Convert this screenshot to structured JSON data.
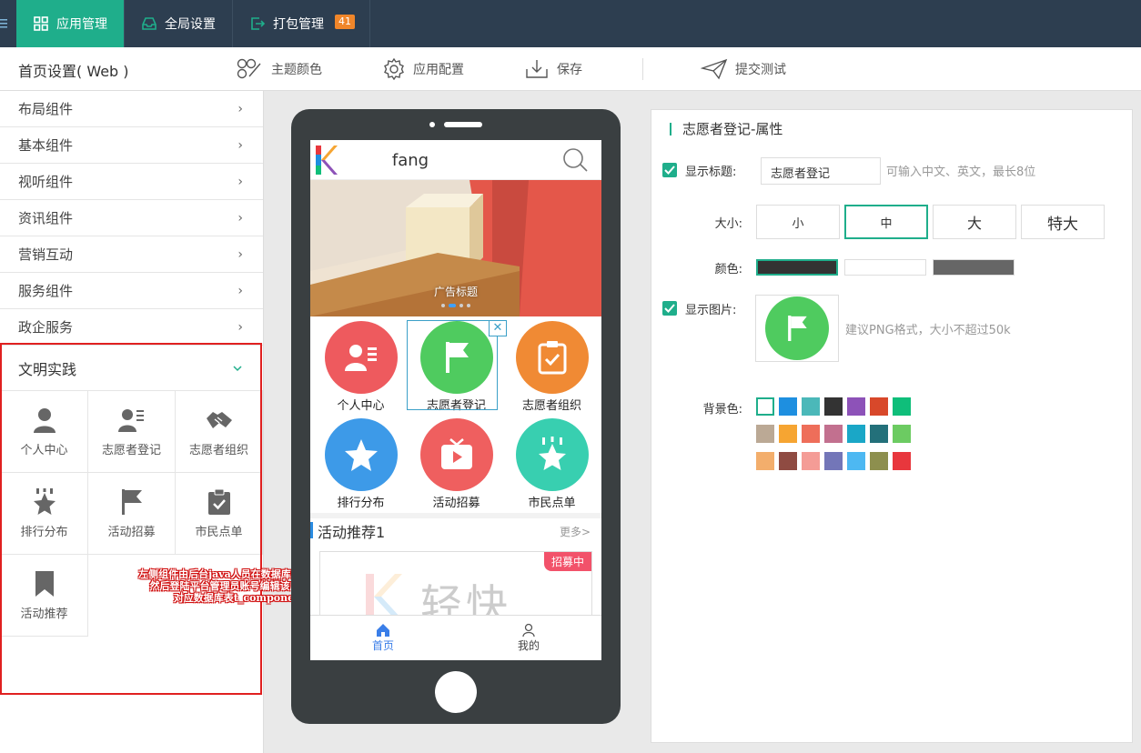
{
  "topbar": {
    "tabs": [
      {
        "label": "应用管理",
        "icon": "grid-icon",
        "active": true
      },
      {
        "label": "全局设置",
        "icon": "inbox-icon",
        "active": false
      },
      {
        "label": "打包管理",
        "icon": "export-icon",
        "active": false,
        "badge": "41"
      }
    ]
  },
  "subbar": {
    "page_title": "首页设置( Web )",
    "theme_color": "主题颜色",
    "app_config": "应用配置",
    "save": "保存",
    "submit_test": "提交测试"
  },
  "sidebar": {
    "categories": [
      "布局组件",
      "基本组件",
      "视听组件",
      "资讯组件",
      "营销互动",
      "服务组件",
      "政企服务"
    ],
    "expanded": {
      "label": "文明实践",
      "items": [
        "个人中心",
        "志愿者登记",
        "志愿者组织",
        "排行分布",
        "活动招募",
        "市民点单",
        "活动推荐"
      ]
    },
    "annotation": [
      "左侧组件由后台java人员在数据库操作生成，",
      "然后登陆平台管理员账号编辑该应用组件",
      "对应数据库表t_component"
    ]
  },
  "phone": {
    "app_name": "fang",
    "banner_caption": "广告标题",
    "icons": [
      {
        "label": "个人中心",
        "color": "#ee5a5e"
      },
      {
        "label": "志愿者登记",
        "color": "#4fcb5f"
      },
      {
        "label": "志愿者组织",
        "color": "#f08a34"
      },
      {
        "label": "排行分布",
        "color": "#3d9ae8"
      },
      {
        "label": "活动招募",
        "color": "#ef5f5f"
      },
      {
        "label": "市民点单",
        "color": "#38cfb0"
      }
    ],
    "close": "✕",
    "recommend_title": "活动推荐1",
    "more": "更多>",
    "tag": "招募中",
    "card_text": "轻快",
    "tabbar": [
      {
        "label": "首页",
        "active": true
      },
      {
        "label": "我的",
        "active": false
      }
    ]
  },
  "props": {
    "title": "志愿者登记-属性",
    "show_title_label": "显示标题:",
    "title_value": "志愿者登记",
    "title_hint": "可输入中文、英文，最长8位",
    "size_label": "大小:",
    "sizes": [
      "小",
      "中",
      "大",
      "特大"
    ],
    "selected_size": "中",
    "color_label": "颜色:",
    "colors": [
      "#333333",
      "#ffffff",
      "#666666"
    ],
    "show_image_label": "显示图片:",
    "image_hint": "建议PNG格式，大小不超过50k",
    "bg_label": "背景色:",
    "bg_colors": [
      [
        "#ffffff",
        "#1e8fe0",
        "#4bb8b9",
        "#333333",
        "#8d52b8",
        "#d8482a",
        "#0fbe7a"
      ],
      [
        "#bba995",
        "#f6a532",
        "#ee6e5a",
        "#c2708f",
        "#1aa7c7",
        "#23707a",
        "#6ccb62"
      ],
      [
        "#f3ae6c",
        "#8f4b42",
        "#f49c96",
        "#7376b8",
        "#4db8f2",
        "#8d8f4e",
        "#e8373d"
      ]
    ]
  }
}
